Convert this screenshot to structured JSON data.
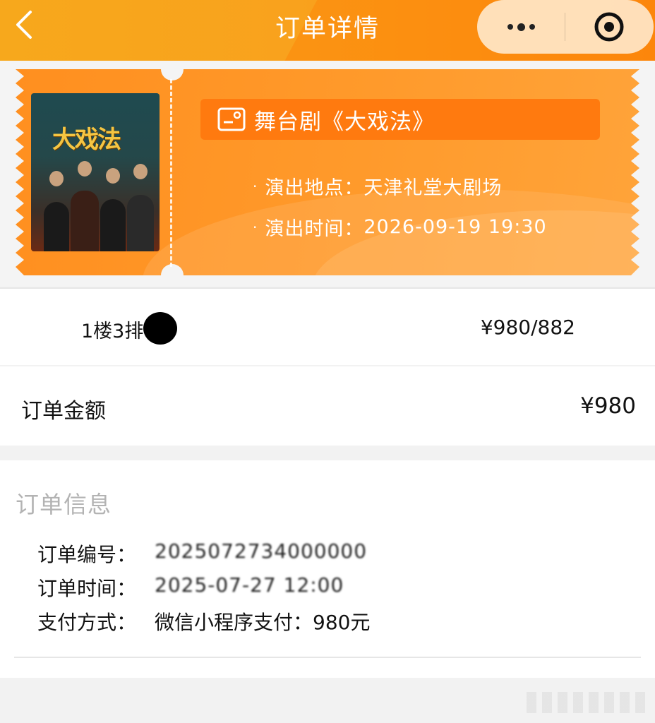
{
  "header": {
    "title": "订单详情",
    "back_icon": "chevron-left-icon",
    "more_icon": "more-dots-icon",
    "target_icon": "target-icon",
    "bg_color": "#f9a21d"
  },
  "ticket": {
    "show_title": "舞台剧《大戏法》",
    "poster_title": "大戏法",
    "bullet": "·",
    "venue_label": "演出地点：",
    "venue": "天津礼堂大剧场",
    "time_label": "演出时间：",
    "time": "2026-09-19 19:30",
    "accent_color": "#ff8f1f"
  },
  "seat": {
    "label": "1楼3排  号",
    "price": "¥980/882"
  },
  "order_amount": {
    "label": "订单金额",
    "value": "¥980"
  },
  "order_info": {
    "heading": "订单信息",
    "number_label": "订单编号：",
    "number_value": "2025072734000000",
    "time_label": "订单时间：",
    "time_value": "2025-07-27 12:00",
    "payment_label": "支付方式：",
    "payment_value": "微信小程序支付：980元"
  }
}
